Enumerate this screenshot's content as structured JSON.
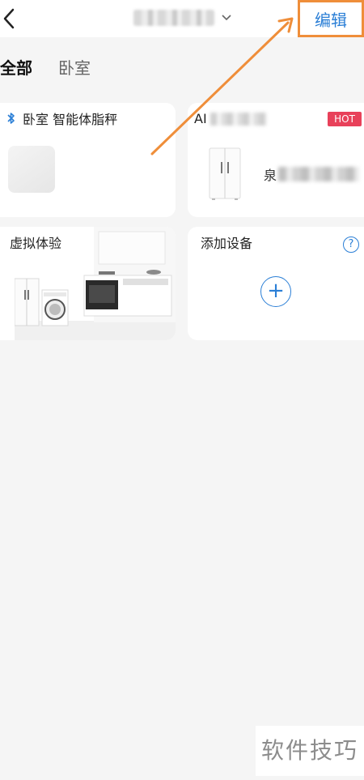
{
  "header": {
    "edit_label": "编辑"
  },
  "tabs": [
    {
      "label": "全部"
    },
    {
      "label": "卧室"
    }
  ],
  "cards": [
    {
      "title": "卧室 智能体脂秤"
    },
    {
      "title": "AI",
      "badge": "HOT",
      "subtitle": "泉"
    },
    {
      "title": "虚拟体验"
    },
    {
      "title": "添加设备",
      "help": "?",
      "add": "+"
    }
  ],
  "watermark": "软件技巧",
  "colors": {
    "accent": "#2b7fd6",
    "highlight": "#ef8e3a",
    "hot_badge": "#e8415a"
  }
}
